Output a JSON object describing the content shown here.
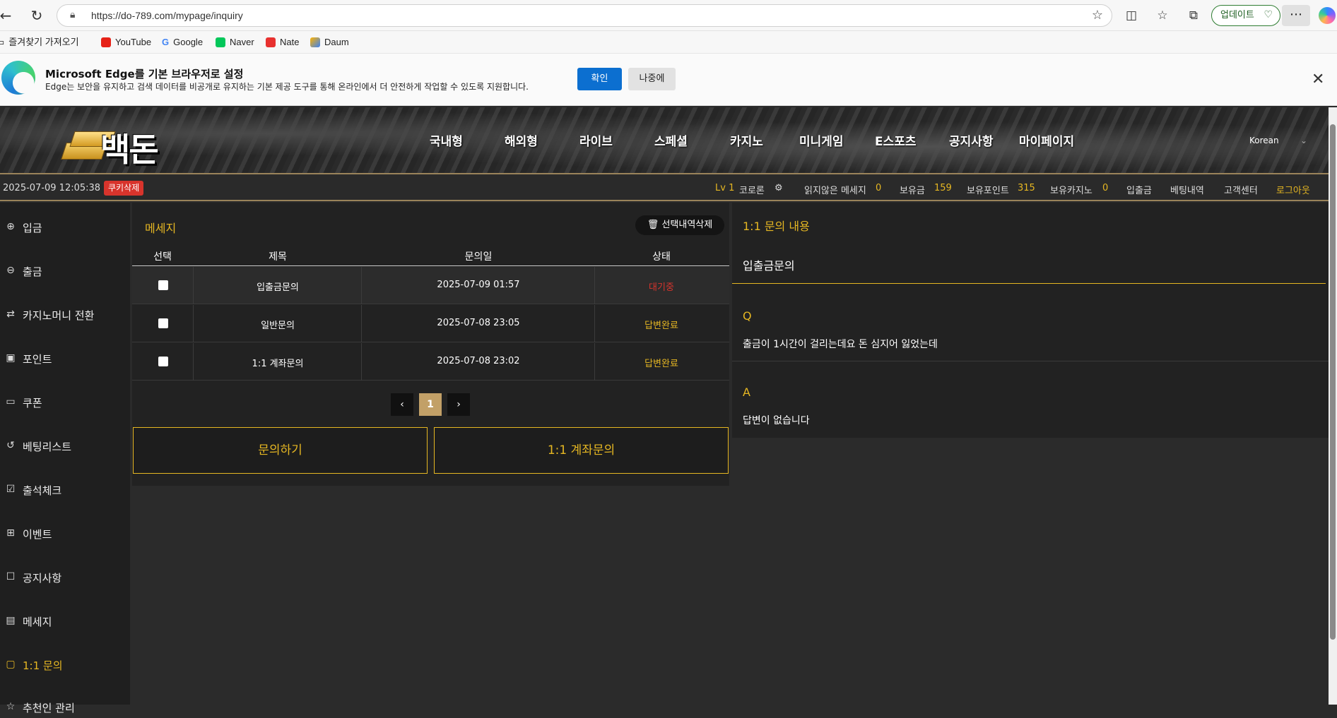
{
  "browser": {
    "url": "https://do-789.com/mypage/inquiry",
    "update_label": "업데이트",
    "bookmarks": [
      "즐겨찾기 가져오기",
      "YouTube",
      "Google",
      "Naver",
      "Nate",
      "Daum"
    ]
  },
  "infobar": {
    "title": "Microsoft Edge를 기본 브라우저로 설정",
    "desc": "Edge는 보안을 유지하고 검색 데이터를 비공개로 유지하는 기본 제공 도구를 통해 온라인에서 더 안전하게 작업할 수 있도록 지원합니다.",
    "confirm": "확인",
    "later": "나중에"
  },
  "site": {
    "logo_text": "백돈",
    "nav": [
      "국내형",
      "해외형",
      "라이브",
      "스페셜",
      "카지노",
      "미니게임",
      "E스포츠",
      "공지사항",
      "마이페이지"
    ],
    "lang": "Korean"
  },
  "status": {
    "datetime": "2025-07-09 12:05:38",
    "cookie": "쿠키삭제",
    "level": "Lv 1",
    "nickname": "코로론",
    "unread_label": "읽지않은 메세지",
    "unread": "0",
    "cash_label": "보유금",
    "cash": "159",
    "point_label": "보유포인트",
    "point": "315",
    "casino_label": "보유카지노",
    "casino": "0",
    "deposit": "입출금",
    "bet_history": "베팅내역",
    "support": "고객센터",
    "logout": "로그아웃"
  },
  "sidebar": {
    "items": [
      {
        "label": "입금",
        "icon": "deposit-icon"
      },
      {
        "label": "출금",
        "icon": "withdraw-icon"
      },
      {
        "label": "카지노머니 전환",
        "icon": "exchange-icon"
      },
      {
        "label": "포인트",
        "icon": "point-icon"
      },
      {
        "label": "쿠폰",
        "icon": "coupon-icon"
      },
      {
        "label": "베팅리스트",
        "icon": "history-icon"
      },
      {
        "label": "출석체크",
        "icon": "calendar-check-icon"
      },
      {
        "label": "이벤트",
        "icon": "gift-icon"
      },
      {
        "label": "공지사항",
        "icon": "clipboard-icon"
      },
      {
        "label": "메세지",
        "icon": "message-icon"
      },
      {
        "label": "1:1 문의",
        "icon": "chat-icon"
      },
      {
        "label": "추천인 관리",
        "icon": "referral-icon"
      }
    ]
  },
  "messages": {
    "title": "메세지",
    "delete_selected": "선택내역삭제",
    "columns": [
      "선택",
      "제목",
      "문의일",
      "상태"
    ],
    "rows": [
      {
        "title": "입출금문의",
        "date": "2025-07-09 01:57",
        "status": "대기중"
      },
      {
        "title": "일반문의",
        "date": "2025-07-08 23:05",
        "status": "답변완료"
      },
      {
        "title": "1:1 계좌문의",
        "date": "2025-07-08 23:02",
        "status": "답변완료"
      }
    ],
    "page": "1",
    "inquire_button": "문의하기",
    "account_inquiry_button": "1:1 계좌문의"
  },
  "detail": {
    "title": "1:1 문의 내용",
    "subject": "입출금문의",
    "q_label": "Q",
    "question": "출금이 1시간이 걸리는데요 돈 심지어 잃었는데",
    "a_label": "A",
    "answer": "답변이 없습니다"
  },
  "colors": {
    "accent": "#e6b722",
    "danger": "#d8342c",
    "pager_active": "#c2a067"
  }
}
